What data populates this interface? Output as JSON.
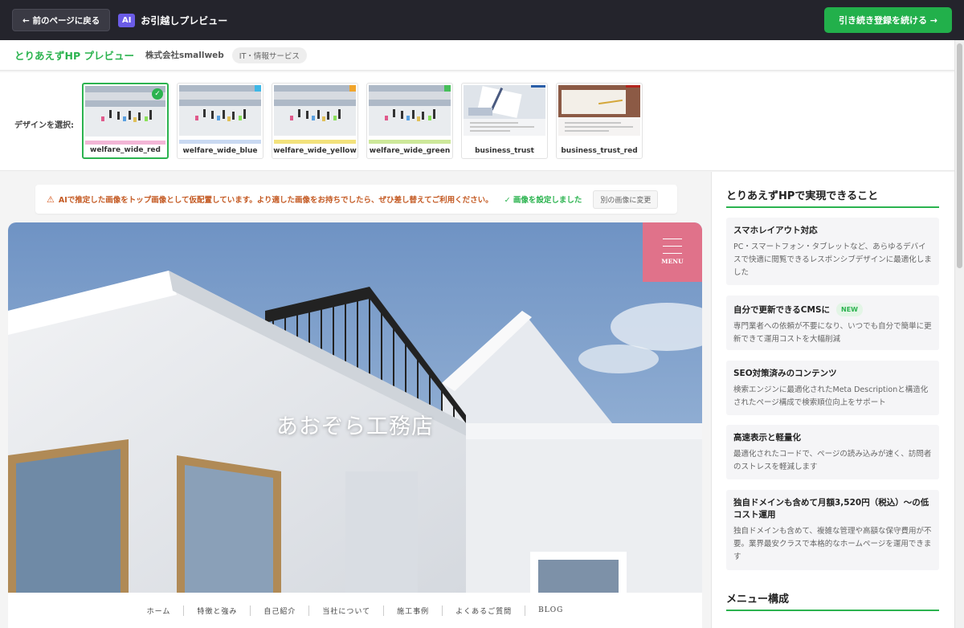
{
  "topbar": {
    "back_label": "← 前のページに戻る",
    "ai_badge": "AI",
    "title": "お引越しプレビュー",
    "continue_label": "引き続き登録を続ける →"
  },
  "header": {
    "title": "とりあえずHP プレビュー",
    "company": "株式会社smallweb",
    "industry": "IT・情報サービス"
  },
  "picker": {
    "label": "デザインを選択:",
    "designs": [
      {
        "name": "welfare_wide_red",
        "accent": "#e8748d",
        "stripe": "#f2b6d6",
        "selected": true
      },
      {
        "name": "welfare_wide_blue",
        "accent": "#3fb7e6",
        "stripe": "#c9d9f2",
        "selected": false
      },
      {
        "name": "welfare_wide_yellow",
        "accent": "#f0a52c",
        "stripe": "#f3e27c",
        "selected": false
      },
      {
        "name": "welfare_wide_green",
        "accent": "#47bf5a",
        "stripe": "#cde89a",
        "selected": false
      },
      {
        "name": "business_trust",
        "accent": "#2a5fa8",
        "stripe": "#ffffff",
        "selected": false
      },
      {
        "name": "business_trust_red",
        "accent": "#b3261e",
        "stripe": "#ffffff",
        "selected": false
      }
    ]
  },
  "notice": {
    "warning": "AIで推定した画像をトップ画像として仮配置しています。より適した画像をお持ちでしたら、ぜひ差し替えてご利用ください。",
    "ok": "✓ 画像を設定しました",
    "change_label": "別の画像に変更"
  },
  "site": {
    "name": "あおぞら工務店",
    "menu_label": "MENU",
    "nav": [
      "ホーム",
      "特徴と強み",
      "自己紹介",
      "当社について",
      "施工事例",
      "よくあるご質問",
      "BLOG"
    ]
  },
  "sidebar": {
    "heading": "とりあえずHPで実現できること",
    "features": [
      {
        "title": "スマホレイアウト対応",
        "desc": "PC・スマートフォン・タブレットなど、あらゆるデバイスで快適に閲覧できるレスポンシブデザインに最適化しました"
      },
      {
        "title": "自分で更新できるCMSに",
        "badge": "NEW",
        "desc": "専門業者への依頼が不要になり、いつでも自分で簡単に更新できて運用コストを大幅削減"
      },
      {
        "title": "SEO対策済みのコンテンツ",
        "desc": "検索エンジンに最適化されたMeta Descriptionと構造化されたページ構成で検索順位向上をサポート"
      },
      {
        "title": "高速表示と軽量化",
        "desc": "最適化されたコードで、ページの読み込みが速く、訪問者のストレスを軽減します"
      },
      {
        "title": "独自ドメインも含めて月額3,520円（税込）〜の低コスト運用",
        "desc": "独自ドメインも含めて、複雑な管理や高額な保守費用が不要。業界最安クラスで本格的なホームページを運用できます"
      }
    ],
    "menu_heading": "メニュー構成"
  },
  "colors": {
    "brand_green": "#2bb34f",
    "menu_pink": "#e0728a",
    "topbar_dark": "#24242c",
    "ai_purple": "#6b5ce7"
  }
}
